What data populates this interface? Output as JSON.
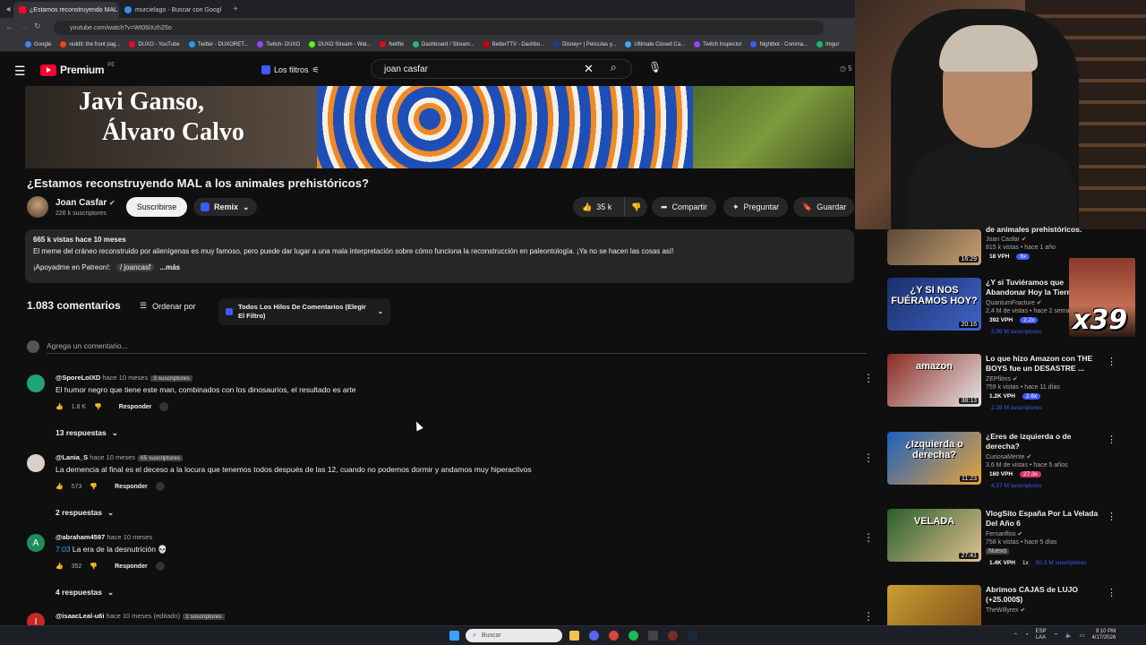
{
  "browser": {
    "tabs": [
      {
        "title": "¿Estamos reconstruyendo MAL",
        "active": true
      },
      {
        "title": "murcielago - Buscar con Googl",
        "active": false
      }
    ],
    "url": "youtube.com/watch?v=Wt06iXzhZ6o",
    "bookmarks": [
      "Google",
      "reddit: the front pag...",
      "DUXO - YouTube",
      "Twitter - DUXORET...",
      "Twitch- DUXO",
      "DUXO Stream - Wat...",
      "Netflix",
      "Dashboard / Stream...",
      "BetterTTV - Dashbo...",
      "Disney+ | Películas y...",
      "Ultimate Closed Ca...",
      "Twitch Inspector",
      "Nightbot - Comma...",
      "Imgur"
    ]
  },
  "header": {
    "logo": "Premium",
    "logo_region": "PE",
    "filters_label": "Los filtros",
    "search_value": "joan casfar",
    "clock_fragment": "5"
  },
  "banner": {
    "line1": "Javi Ganso,",
    "line2": "Álvaro Calvo"
  },
  "video": {
    "title": "¿Estamos reconstruyendo MAL a los animales prehistóricos?",
    "channel": "Joan Casfar",
    "verified": "✔",
    "subscribers": "226 k suscriptores",
    "subscribe_label": "Suscribirse",
    "remix_label": "Remix",
    "likes": "35 k",
    "share_label": "Compartir",
    "ask_label": "Preguntar",
    "save_label": "Guardar"
  },
  "description": {
    "stats": "665 k vistas  hace 10 meses",
    "text": "El meme del cráneo reconstruido por alienígenas es muy famoso, pero puede dar lugar a una mala interpretación sobre cómo funciona la reconstrucción en paleontología. ¡Ya no se hacen las cosas así!",
    "patreon": "¡Apoyadme en Patreon!:",
    "patreon_link": "/ joancasf",
    "more": "...más"
  },
  "comments_header": {
    "count": "1.083 comentarios",
    "sort_label": "Ordenar por",
    "filter_label": "Todos Los Hilos De Comentarios (Elegir El Filtro)",
    "add_placeholder": "Agrega un comentario..."
  },
  "comments": [
    {
      "author": "@SporeLoIXD",
      "time": "hace 10 meses",
      "badge": "3 suscriptores",
      "text": "El humor negro que tiene este man, combinados con los dinosaurios, el resultado es arte",
      "timestamp": "",
      "likes": "1.8 K",
      "reply": "Responder",
      "replies": "13 respuestas",
      "avatar_color": "#1fa37a"
    },
    {
      "author": "@Lania_S",
      "time": "hace 10 meses",
      "badge": "65 suscriptores",
      "text": "La demencia al final es el deceso a la locura que tenemos todos después de las 12, cuando no podemos dormir y andamos muy hiperactivos",
      "timestamp": "",
      "likes": "573",
      "reply": "Responder",
      "replies": "2 respuestas",
      "avatar_color": "#d9d0cc"
    },
    {
      "author": "@abraham4597",
      "time": "hace 10 meses",
      "badge": "",
      "text": "La era de la desnutrición 💀",
      "timestamp": "7:03",
      "likes": "352",
      "reply": "Responder",
      "replies": "4 respuestas",
      "avatar_color": "#1e8e5a",
      "initial": "A"
    },
    {
      "author": "@isaacLeal-u6i",
      "time": "hace 10 meses (editado)",
      "badge": "1 suscriptores",
      "text": "",
      "timestamp": "",
      "likes": "",
      "reply": "",
      "replies": "",
      "avatar_color": "#c62828",
      "initial": "I"
    }
  ],
  "sidebar": [
    {
      "title": "de animales prehistóricos.",
      "channel": "Joan Casfar",
      "stats": "815 k vistas • hace 1 año",
      "duration": "16:29",
      "vph": "18 VPH",
      "x": "6x",
      "subs": "",
      "thumb": [
        "#5a4a3a",
        "#c8a070"
      ]
    },
    {
      "title": "¿Y si Tuviéramos que Abandonar Hoy la Tierra",
      "channel": "QuantumFracture",
      "stats": "2,4 M de vistas • hace 2 seman",
      "duration": "20:16",
      "vph": "392 VPH",
      "x": "2.2x",
      "subs": "3.99 M suscriptores",
      "thumb": [
        "#1a2f6a",
        "#3f63c8"
      ],
      "thumb_text": "¿Y SI NOS FUÉRAMOS HOY?"
    },
    {
      "title": "Lo que hizo Amazon con THE BOYS fue un DESASTRE ...",
      "channel": "ZEPfilms",
      "stats": "759 k vistas • hace 11 días",
      "duration": "38:13",
      "vph": "1.2K VPH",
      "x": "2.6x",
      "subs": "2.28 M suscriptores",
      "thumb": [
        "#8a2a22",
        "#e6e6e6"
      ],
      "thumb_text": "amazon"
    },
    {
      "title": "¿Eres de izquierda o de derecha?",
      "channel": "CuriosaMente",
      "stats": "3,6 M de vistas • hace 5 años",
      "duration": "11:23",
      "vph": "160 VPH",
      "x": "27.3x",
      "subs": "4.57 M suscriptores",
      "thumb": [
        "#1c5fbf",
        "#e8a43a"
      ],
      "thumb_text": "¿Izquierda o derecha?"
    },
    {
      "title": "VlogSito España Por La Velada Del Año 6",
      "channel": "Fernanfloo",
      "stats": "758 k vistas • hace 5 días",
      "duration": "27:41",
      "vph": "1.4K VPH",
      "x": "1x",
      "subs": "50.3 M suscriptores",
      "badge": "Nuevo",
      "thumb": [
        "#2b5f2b",
        "#e0c090"
      ],
      "thumb_text": "VELADA"
    },
    {
      "title": "Abrimos CAJAS de LUJO (+25.000$)",
      "channel": "TheWillyrex",
      "stats": "",
      "duration": "",
      "vph": "",
      "x": "",
      "subs": "",
      "thumb": [
        "#c9a030",
        "#7a4a1a"
      ]
    }
  ],
  "overlay": {
    "label": "x39"
  },
  "taskbar": {
    "search_placeholder": "Buscar",
    "lang": "ESP\nLAA",
    "time": "9:10 PM",
    "date": "4/17/2026"
  },
  "colors": {
    "bg": "#0f0f0f",
    "accent": "#ff0033",
    "link": "#3ea6ff",
    "ext": "#3d5afe"
  }
}
